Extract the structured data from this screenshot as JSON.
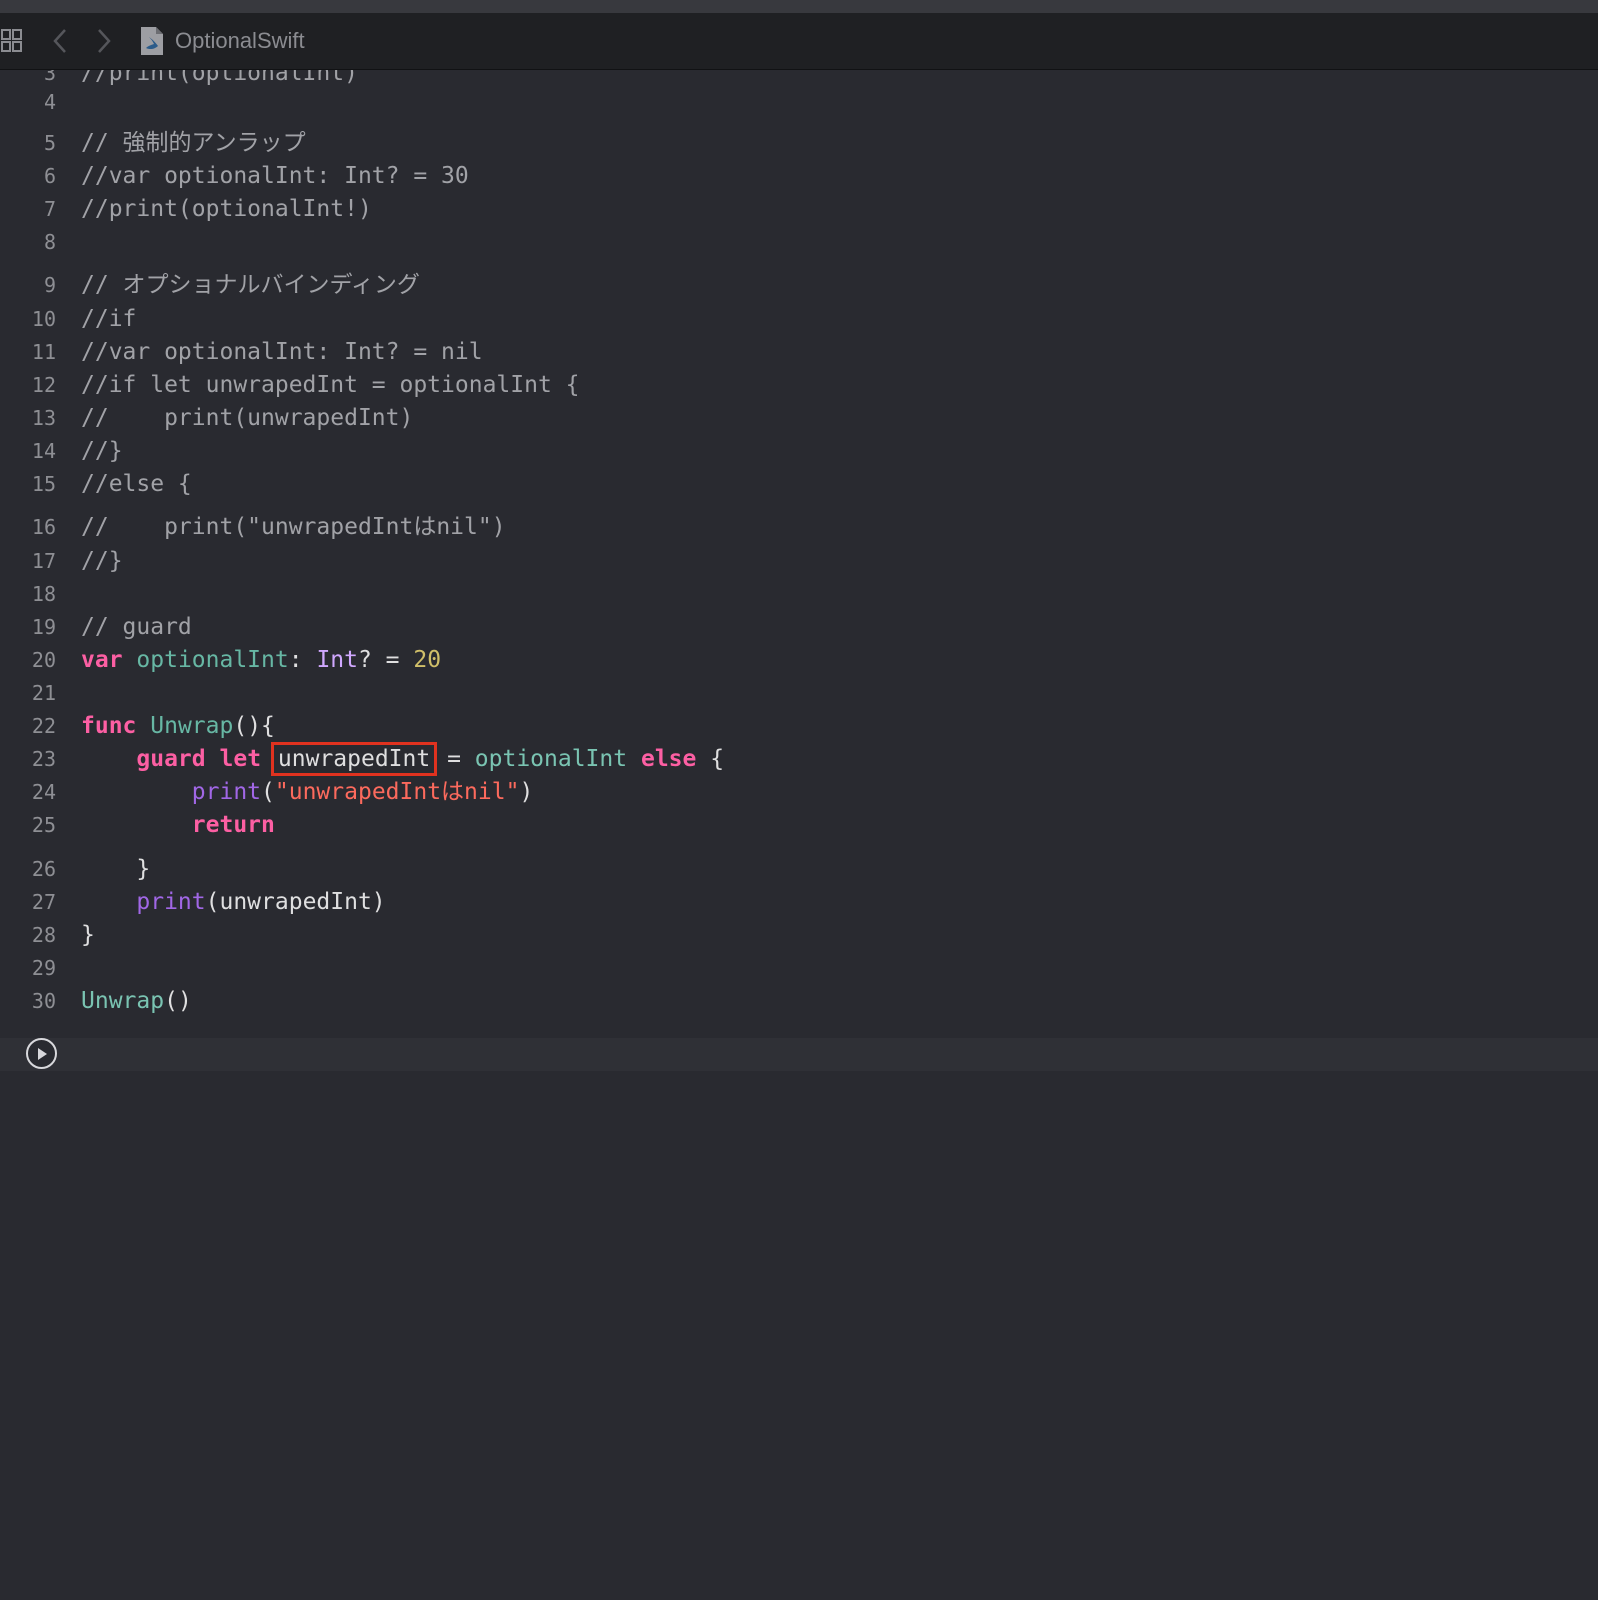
{
  "toolbar": {
    "file_name": "OptionalSwift",
    "icons": [
      "grid-icon",
      "back-chevron-icon",
      "forward-chevron-icon",
      "swift-file-icon"
    ]
  },
  "colors": {
    "background": "#292a30",
    "comment": "#a1a2a7",
    "keyword": "#fc5fa3",
    "string": "#fc6a5d",
    "number": "#d0bf69",
    "highlight_box": "#e0321f"
  },
  "editor": {
    "partial_top_line": {
      "number": "3",
      "text": "//print(optionalInt)"
    },
    "lines": [
      {
        "n": "4",
        "tokens": []
      },
      {
        "n": "5",
        "tokens": [
          {
            "t": "// 強制的アンラップ",
            "c": "comment"
          }
        ]
      },
      {
        "n": "6",
        "tokens": [
          {
            "t": "//var optionalInt: Int? = 30",
            "c": "comment"
          }
        ]
      },
      {
        "n": "7",
        "tokens": [
          {
            "t": "//print(optionalInt!)",
            "c": "comment"
          }
        ]
      },
      {
        "n": "8",
        "tokens": []
      },
      {
        "n": "9",
        "tokens": [
          {
            "t": "// オプショナルバインディング",
            "c": "comment"
          }
        ]
      },
      {
        "n": "10",
        "tokens": [
          {
            "t": "//if",
            "c": "comment"
          }
        ]
      },
      {
        "n": "11",
        "tokens": [
          {
            "t": "//var optionalInt: Int? = nil",
            "c": "comment"
          }
        ]
      },
      {
        "n": "12",
        "tokens": [
          {
            "t": "//if let unwrapedInt = optionalInt {",
            "c": "comment"
          }
        ]
      },
      {
        "n": "13",
        "tokens": [
          {
            "t": "//    print(unwrapedInt)",
            "c": "comment"
          }
        ]
      },
      {
        "n": "14",
        "tokens": [
          {
            "t": "//}",
            "c": "comment"
          }
        ]
      },
      {
        "n": "15",
        "tokens": [
          {
            "t": "//else {",
            "c": "comment"
          }
        ]
      },
      {
        "n": "16",
        "tokens": [
          {
            "t": "//    print(\"unwrapedIntはnil\")",
            "c": "comment"
          }
        ]
      },
      {
        "n": "17",
        "tokens": [
          {
            "t": "//}",
            "c": "comment"
          }
        ]
      },
      {
        "n": "18",
        "tokens": []
      },
      {
        "n": "19",
        "tokens": [
          {
            "t": "// guard",
            "c": "comment"
          }
        ]
      },
      {
        "n": "20",
        "tokens": [
          {
            "t": "var",
            "c": "keyword"
          },
          {
            "t": " ",
            "c": "plain"
          },
          {
            "t": "optionalInt",
            "c": "decl"
          },
          {
            "t": ": ",
            "c": "plain"
          },
          {
            "t": "Int",
            "c": "type"
          },
          {
            "t": "? = ",
            "c": "plain"
          },
          {
            "t": "20",
            "c": "number"
          }
        ]
      },
      {
        "n": "21",
        "tokens": []
      },
      {
        "n": "22",
        "tokens": [
          {
            "t": "func",
            "c": "keyword"
          },
          {
            "t": " ",
            "c": "plain"
          },
          {
            "t": "Unwrap",
            "c": "decl"
          },
          {
            "t": "(){",
            "c": "plain"
          }
        ]
      },
      {
        "n": "23",
        "tokens": [
          {
            "t": "    ",
            "c": "plain"
          },
          {
            "t": "guard",
            "c": "keyword"
          },
          {
            "t": " ",
            "c": "plain"
          },
          {
            "t": "let",
            "c": "keyword"
          },
          {
            "t": " ",
            "c": "plain"
          },
          {
            "t": "unwrapedInt",
            "c": "plain",
            "hl": true
          },
          {
            "t": " = ",
            "c": "plain"
          },
          {
            "t": "optionalInt",
            "c": "call"
          },
          {
            "t": " ",
            "c": "plain"
          },
          {
            "t": "else",
            "c": "keyword"
          },
          {
            "t": " {",
            "c": "plain"
          }
        ]
      },
      {
        "n": "24",
        "tokens": [
          {
            "t": "        ",
            "c": "plain"
          },
          {
            "t": "print",
            "c": "builtin"
          },
          {
            "t": "(",
            "c": "plain"
          },
          {
            "t": "\"unwrapedIntはnil\"",
            "c": "string"
          },
          {
            "t": ")",
            "c": "plain"
          }
        ]
      },
      {
        "n": "25",
        "tokens": [
          {
            "t": "        ",
            "c": "plain"
          },
          {
            "t": "return",
            "c": "keyword"
          }
        ]
      },
      {
        "n": "26",
        "tokens": [
          {
            "t": "    }",
            "c": "plain"
          }
        ]
      },
      {
        "n": "27",
        "tokens": [
          {
            "t": "    ",
            "c": "plain"
          },
          {
            "t": "print",
            "c": "builtin"
          },
          {
            "t": "(unwrapedInt)",
            "c": "plain"
          }
        ]
      },
      {
        "n": "28",
        "tokens": [
          {
            "t": "}",
            "c": "plain"
          }
        ]
      },
      {
        "n": "29",
        "tokens": []
      },
      {
        "n": "30",
        "tokens": [
          {
            "t": "Unwrap",
            "c": "call"
          },
          {
            "t": "()",
            "c": "plain"
          }
        ]
      }
    ]
  }
}
